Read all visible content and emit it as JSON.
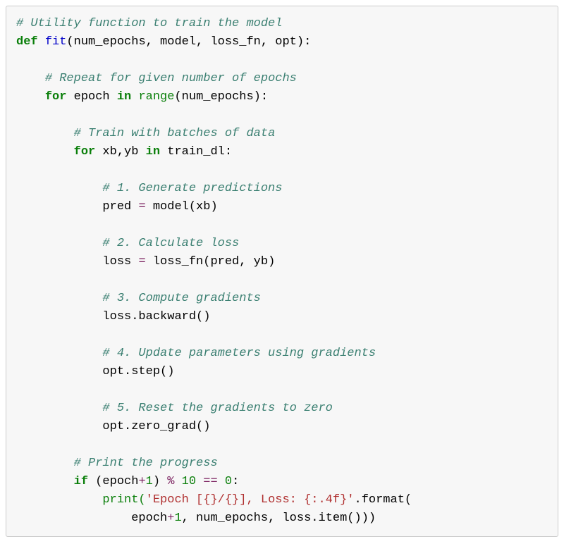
{
  "code": {
    "c1": "# Utility function to train the model",
    "kw_def": "def",
    "fn_name": "fit",
    "params": "(num_epochs, model, loss_fn, opt):",
    "c2": "# Repeat for given number of epochs",
    "kw_for1": "for",
    "var_epoch": " epoch ",
    "kw_in1": "in",
    "bi_range": " range",
    "range_args": "(num_epochs):",
    "c3": "# Train with batches of data",
    "kw_for2": "for",
    "var_xbyb": " xb,yb ",
    "kw_in2": "in",
    "train_dl": " train_dl:",
    "c4": "# 1. Generate predictions",
    "pred_lhs": "pred ",
    "op_eq1": "=",
    "pred_rhs": " model(xb)",
    "c5": "# 2. Calculate loss",
    "loss_lhs": "loss ",
    "op_eq2": "=",
    "loss_rhs": " loss_fn(pred, yb)",
    "c6": "# 3. Compute gradients",
    "backward": "loss.backward()",
    "c7": "# 4. Update parameters using gradients",
    "step": "opt.step()",
    "c8": "# 5. Reset the gradients to zero",
    "zerograd": "opt.zero_grad()",
    "c9": "# Print the progress",
    "kw_if": "if",
    "if_open": " (epoch",
    "op_plus1": "+",
    "num_1a": "1",
    "if_cont": ") ",
    "op_mod": "%",
    "num_10": " 10 ",
    "op_eqeq": "==",
    "num_0": " 0",
    "if_close": ":",
    "print_open": "print(",
    "str_fmt": "'Epoch [{}/{}], Loss: {:.4f}'",
    "format_call": ".format(",
    "fmt_args_pre": "epoch",
    "op_plus2": "+",
    "num_1b": "1",
    "fmt_args_post": ", num_epochs, loss.item()))"
  }
}
